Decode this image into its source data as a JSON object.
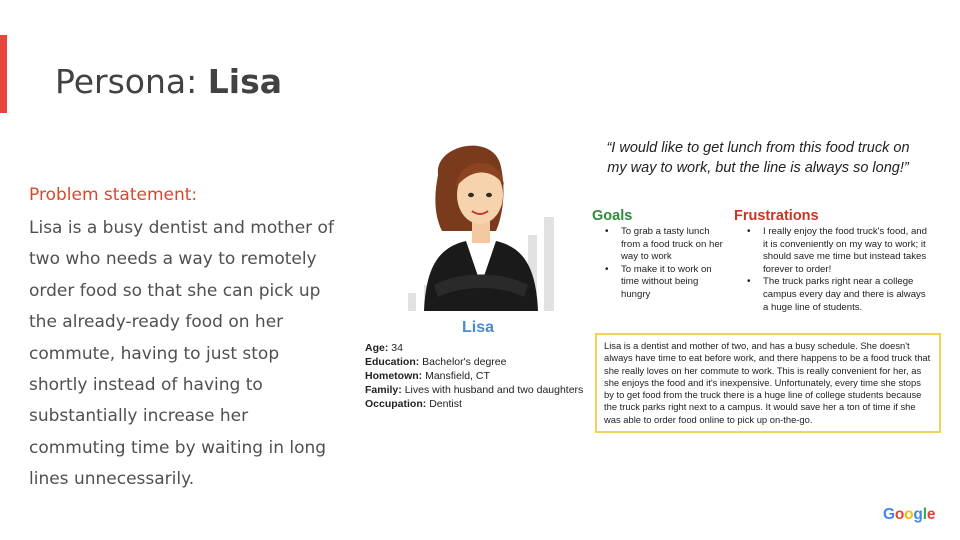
{
  "slide": {
    "title_prefix": "Persona: ",
    "title_name": "Lisa"
  },
  "problem": {
    "heading": "Problem statement:",
    "text": "Lisa is a busy dentist and mother of two who needs a way to remotely order food so that she can pick up the already-ready food on her commute, having to just stop shortly instead of having to substantially increase her commuting time by waiting in long lines unnecessarily."
  },
  "persona": {
    "name": "Lisa",
    "details": [
      {
        "label": "Age:",
        "value": "34"
      },
      {
        "label": "Education:",
        "value": "Bachelor's degree"
      },
      {
        "label": "Hometown:",
        "value": "Mansfield, CT"
      },
      {
        "label": "Family:",
        "value": "Lives with husband and two daughters"
      },
      {
        "label": "Occupation:",
        "value": "Dentist"
      }
    ],
    "quote": "“I would like to get lunch from this food truck on my way to work, but the line is always so long!”",
    "goals_heading": "Goals",
    "goals": [
      "To grab a tasty lunch from a food truck on her way to work",
      "To make it to work on time without being hungry"
    ],
    "frustrations_heading": "Frustrations",
    "frustrations": [
      "I really enjoy the food truck's food, and it is conveniently on my way to work; it should save me time but instead takes forever to order!",
      "The truck parks right near a college campus every day and there is always a huge line of students."
    ],
    "summary": "Lisa is a dentist and mother of two, and has a busy schedule. She doesn't always have time to eat before work, and there happens to be a food truck that she really loves on her commute to work. This is really convenient for her, as she enjoys the food and it's inexpensive. Unfortunately, every time she stops by to get food from the truck there is a huge line of college students because the truck parks right next to a campus. It would save her a ton of time if she was able to order food online to pick up on-the-go."
  },
  "logo": {
    "letters": [
      "G",
      "o",
      "o",
      "g",
      "l",
      "e"
    ],
    "colors": [
      "#4285F4",
      "#EA4335",
      "#FBBC05",
      "#4285F4",
      "#34A853",
      "#EA4335"
    ]
  },
  "colors": {
    "accent": "#e8453c",
    "problem_heading": "#d9472b",
    "goals": "#2e8b3a",
    "frustrations": "#cc3320",
    "name": "#4a8bd0",
    "summary_border": "#f3d25a"
  }
}
